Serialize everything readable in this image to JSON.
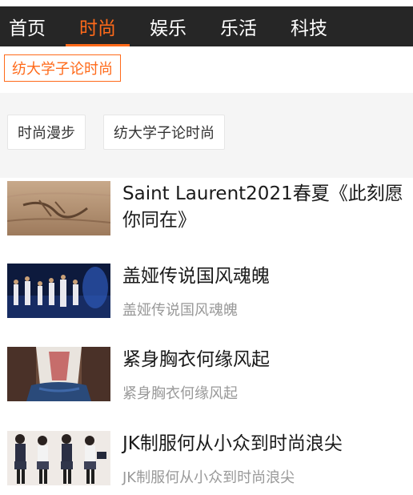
{
  "nav": {
    "items": [
      {
        "label": "首页"
      },
      {
        "label": "时尚"
      },
      {
        "label": "娱乐"
      },
      {
        "label": "乐活"
      },
      {
        "label": "科技"
      }
    ],
    "active_index": 1,
    "active_color": "#ff6a1a",
    "bar_color": "#262626"
  },
  "sub_tag": {
    "label": "纺大学子论时尚"
  },
  "tag_panel": {
    "chips": [
      {
        "label": "时尚漫步"
      },
      {
        "label": "纺大学子论时尚"
      }
    ]
  },
  "articles": [
    {
      "title": "Saint Laurent2021春夏《此刻愿你同在》",
      "subtitle": ""
    },
    {
      "title": "盖娅传说国风魂魄",
      "subtitle": "盖娅传说国风魂魄"
    },
    {
      "title": "紧身胸衣何缘风起",
      "subtitle": "紧身胸衣何缘风起"
    },
    {
      "title": "JK制服何从小众到时尚浪尖",
      "subtitle": "JK制服何从小众到时尚浪尖"
    }
  ]
}
